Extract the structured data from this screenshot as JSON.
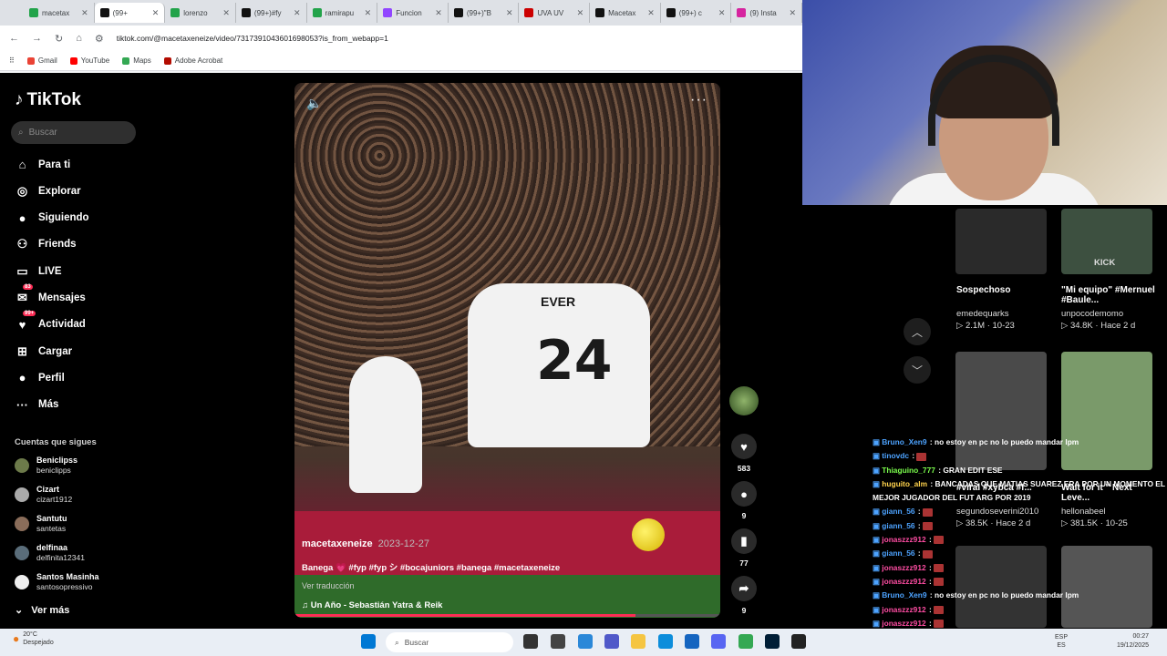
{
  "browser": {
    "tabs": [
      {
        "label": "macetax",
        "color": "#22a34a",
        "active": false
      },
      {
        "label": "(99+",
        "color": "#111111",
        "active": true
      },
      {
        "label": "lorenzo",
        "color": "#22a34a",
        "active": false
      },
      {
        "label": "(99+)#fy",
        "color": "#111111",
        "active": false
      },
      {
        "label": "ramirapu",
        "color": "#22a34a",
        "active": false
      },
      {
        "label": "Funcion",
        "color": "#9146ff",
        "active": false
      },
      {
        "label": "(99+)\"B",
        "color": "#111111",
        "active": false
      },
      {
        "label": "UVA UV",
        "color": "#cc0000",
        "active": false
      },
      {
        "label": "Macetax",
        "color": "#111111",
        "active": false
      },
      {
        "label": "(99+) c",
        "color": "#111111",
        "active": false
      },
      {
        "label": "(9) Insta",
        "color": "#d6249f",
        "active": false
      }
    ],
    "url": "tiktok.com/@macetaxeneize/video/7317391043601698053?is_from_webapp=1",
    "bookmarks": [
      {
        "label": "Gmail",
        "color": "#ea4335"
      },
      {
        "label": "YouTube",
        "color": "#ff0000"
      },
      {
        "label": "Maps",
        "color": "#34a853"
      },
      {
        "label": "Adobe Acrobat",
        "color": "#b30b00"
      }
    ]
  },
  "tiktok": {
    "logo": "TikTok",
    "search_placeholder": "Buscar",
    "nav": [
      {
        "label": "Para ti",
        "icon": "home-icon",
        "glyph": "⌂"
      },
      {
        "label": "Explorar",
        "icon": "compass-icon",
        "glyph": "◎"
      },
      {
        "label": "Siguiendo",
        "icon": "following-icon",
        "glyph": "●"
      },
      {
        "label": "Friends",
        "icon": "friends-icon",
        "glyph": "⚇"
      },
      {
        "label": "LIVE",
        "icon": "live-icon",
        "glyph": "▭"
      },
      {
        "label": "Mensajes",
        "icon": "messages-icon",
        "glyph": "✉",
        "badge": "83"
      },
      {
        "label": "Actividad",
        "icon": "activity-icon",
        "glyph": "♥",
        "badge": "99+"
      },
      {
        "label": "Cargar",
        "icon": "upload-icon",
        "glyph": "⊞"
      },
      {
        "label": "Perfil",
        "icon": "profile-icon",
        "glyph": "●"
      },
      {
        "label": "Más",
        "icon": "more-icon",
        "glyph": "···"
      }
    ],
    "following_title": "Cuentas que sigues",
    "following": [
      {
        "name": "Beniclipss",
        "handle": "beniclipps"
      },
      {
        "name": "Cizart",
        "handle": "cizart1912"
      },
      {
        "name": "Santutu",
        "handle": "santetas"
      },
      {
        "name": "delfinaa",
        "handle": "delfinita12341"
      },
      {
        "name": "Santos Masinha",
        "handle": "santosopressivo"
      }
    ],
    "see_more": "Ver más",
    "video": {
      "author": "macetaxeneize",
      "date": "2023-12-27",
      "caption": "Banega 💗 #fyp #fyp シ #bocajuniors #banega #macetaxeneize",
      "translate": "Ver traducción",
      "music": "Un Año - Sebastián Yatra & Reik",
      "jersey_name": "EVER",
      "jersey_number": "24",
      "progress": 0.8
    },
    "actions": [
      {
        "icon": "like-icon",
        "glyph": "♥",
        "count": "583"
      },
      {
        "icon": "comment-icon",
        "glyph": "●",
        "count": "9"
      },
      {
        "icon": "bookmark-icon",
        "glyph": "▮",
        "count": "77"
      },
      {
        "icon": "share-icon",
        "glyph": "➦",
        "count": "9"
      }
    ]
  },
  "recommendations": [
    {
      "title": "Sospechoso",
      "author": "emedequarks",
      "stats": "▷ 2.1M · 10-23",
      "overlay": ""
    },
    {
      "title": "\"Mi equipo\" #Mernuel #Baule...",
      "author": "unpocodemomo",
      "stats": "▷ 34.8K · Hace 2 d",
      "overlay": "KICK"
    },
    {
      "title": "#viral #xybca #f...",
      "author": "segundoseverini2010",
      "stats": "▷ 38.5K · Hace 2 d",
      "overlay": ""
    },
    {
      "title": "Wait for it \" Next Leve...",
      "author": "hellonabeel",
      "stats": "▷ 381.5K · 10-25",
      "overlay": ""
    }
  ],
  "chat": [
    {
      "user": "Bruno_Xen9",
      "color": "#4da3ff",
      "text": "no estoy en pc no lo puedo mandar lpm"
    },
    {
      "user": "tinovdc",
      "color": "#4da3ff",
      "text": ""
    },
    {
      "user": "Thiaguino_777",
      "color": "#7cff4d",
      "text": "GRAN EDIT ESE"
    },
    {
      "user": "huguito_alm",
      "color": "#ffd34d",
      "text": "BANCADAS QUE MATIAS SUAREZ ERA POR UN MOMENTO EL"
    },
    {
      "user": "",
      "color": "#ffffff",
      "text": "MEJOR JUGADOR DEL FUT ARG POR 2019"
    },
    {
      "user": "giann_56",
      "color": "#4da3ff",
      "text": ""
    },
    {
      "user": "giann_56",
      "color": "#4da3ff",
      "text": ""
    },
    {
      "user": "jonaszzz912",
      "color": "#ff4da3",
      "text": ""
    },
    {
      "user": "giann_56",
      "color": "#4da3ff",
      "text": ""
    },
    {
      "user": "jonaszzz912",
      "color": "#ff4da3",
      "text": ""
    },
    {
      "user": "jonaszzz912",
      "color": "#ff4da3",
      "text": ""
    },
    {
      "user": "Bruno_Xen9",
      "color": "#4da3ff",
      "text": "no estoy en pc no lo puedo mandar lpm"
    },
    {
      "user": "jonaszzz912",
      "color": "#ff4da3",
      "text": ""
    },
    {
      "user": "jonaszzz912",
      "color": "#ff4da3",
      "text": ""
    },
    {
      "user": "jonaszzz912",
      "color": "#ff4da3",
      "text": ""
    }
  ],
  "taskbar": {
    "weather_temp": "20°C",
    "weather_desc": "Despejado",
    "search": "Buscar",
    "lang": "ESP",
    "lang2": "ES",
    "time": "00:27",
    "date": "19/12/2025"
  }
}
